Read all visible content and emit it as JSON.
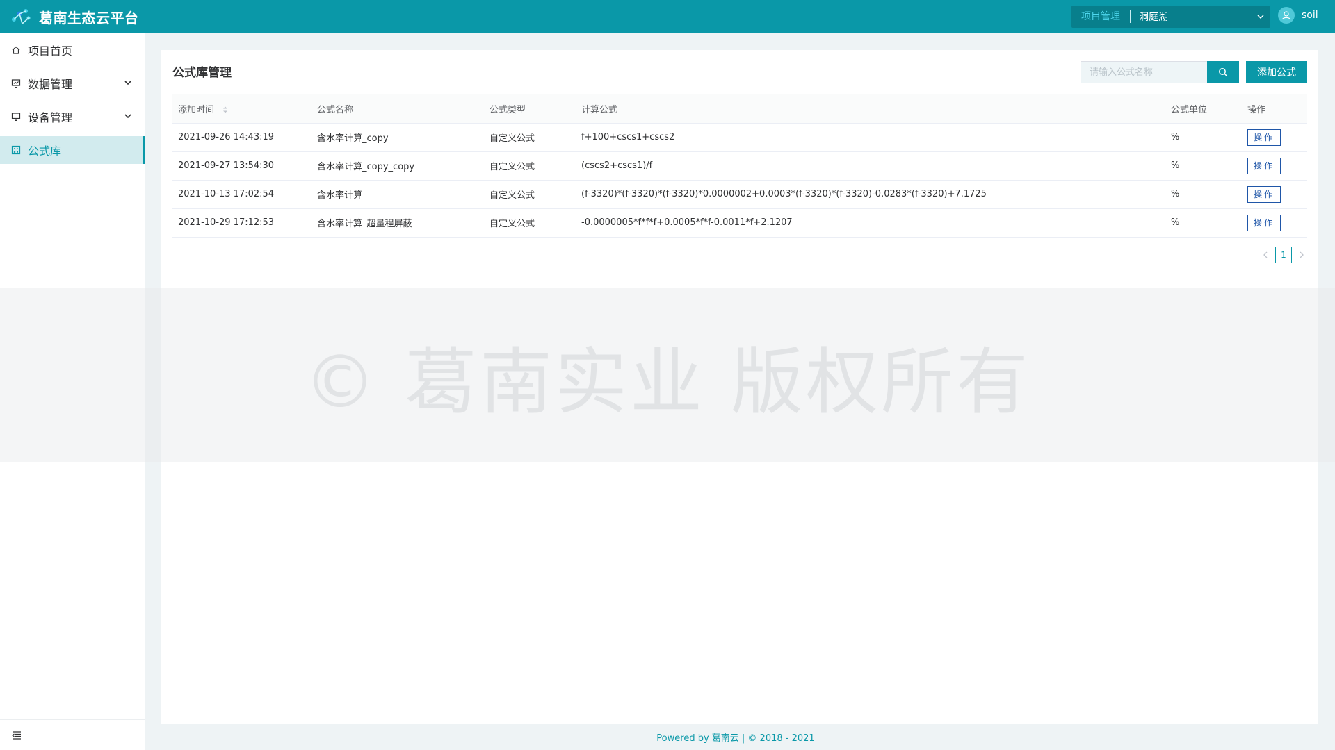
{
  "header": {
    "brand_title": "葛南生态云平台",
    "project_label": "项目管理",
    "project_value": "洞庭湖",
    "user_name": "soil"
  },
  "sidebar": {
    "items": [
      {
        "label": "项目首页",
        "icon": "home-icon"
      },
      {
        "label": "数据管理",
        "icon": "data-icon"
      },
      {
        "label": "设备管理",
        "icon": "monitor-icon"
      },
      {
        "label": "公式库",
        "icon": "formula-icon"
      }
    ]
  },
  "main": {
    "title": "公式库管理",
    "search_placeholder": "请输入公式名称",
    "add_label": "添加公式",
    "columns": [
      "添加时间",
      "公式名称",
      "公式类型",
      "计算公式",
      "公式单位",
      "操作"
    ],
    "rows": [
      {
        "time": "2021-09-26 14:43:19",
        "name": "含水率计算_copy",
        "type": "自定义公式",
        "formula": "f+100+cscs1+cscs2",
        "unit": "%",
        "op": "操作"
      },
      {
        "time": "2021-09-27 13:54:30",
        "name": "含水率计算_copy_copy",
        "type": "自定义公式",
        "formula": "(cscs2+cscs1)/f",
        "unit": "%",
        "op": "操作"
      },
      {
        "time": "2021-10-13 17:02:54",
        "name": "含水率计算",
        "type": "自定义公式",
        "formula": "(f-3320)*(f-3320)*(f-3320)*0.0000002+0.0003*(f-3320)*(f-3320)-0.0283*(f-3320)+7.1725",
        "unit": "%",
        "op": "操作"
      },
      {
        "time": "2021-10-29 17:12:53",
        "name": "含水率计算_超量程屏蔽",
        "type": "自定义公式",
        "formula": "-0.0000005*f*f*f+0.0005*f*f-0.0011*f+2.1207",
        "unit": "%",
        "op": "操作"
      }
    ],
    "pager": {
      "current": "1"
    }
  },
  "watermark": "©   葛南实业 版权所有",
  "footer": "Powered by 葛南云 | © 2018 - 2021",
  "colors": {
    "primary": "#0a98a8",
    "op_button": "#1f56a8"
  }
}
